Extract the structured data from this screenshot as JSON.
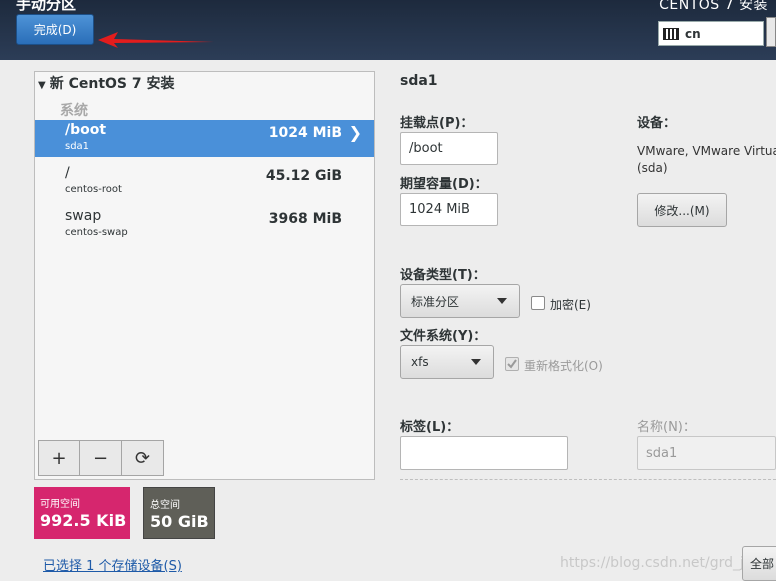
{
  "header": {
    "title": "手动分区",
    "product": "CENTOS 7 安装",
    "done_button": "完成(D)",
    "keyboard_layout": "cn"
  },
  "tree": {
    "root_label": "新 CentOS 7 安装",
    "group_label": "系统",
    "rows": [
      {
        "mount": "/boot",
        "device": "sda1",
        "size": "1024 MiB",
        "selected": true
      },
      {
        "mount": "/",
        "device": "centos-root",
        "size": "45.12 GiB",
        "selected": false
      },
      {
        "mount": "swap",
        "device": "centos-swap",
        "size": "3968 MiB",
        "selected": false
      }
    ]
  },
  "toolbar": {
    "add": "+",
    "remove": "−",
    "reload": "⟳"
  },
  "space": {
    "available_label": "可用空间",
    "available_value": "992.5 KiB",
    "total_label": "总空间",
    "total_value": "50 GiB"
  },
  "storage_link": "已选择 1 个存储设备(S)",
  "details": {
    "title": "sda1",
    "mount_point_label": "挂载点(P)：",
    "mount_point_value": "/boot",
    "capacity_label": "期望容量(D)：",
    "capacity_value": "1024 MiB",
    "device_label": "设备：",
    "device_text_line1": "VMware, VMware Virtua",
    "device_text_line2": "(sda)",
    "modify_button": "修改...(M)",
    "device_type_label": "设备类型(T)：",
    "device_type_value": "标准分区",
    "encrypt_label": "加密(E)",
    "filesystem_label": "文件系统(Y)：",
    "filesystem_value": "xfs",
    "reformat_label": "重新格式化(O)",
    "tag_label": "标签(L)：",
    "tag_value": "",
    "name_label": "名称(N)：",
    "name_value": "sda1",
    "reset_button": "全部"
  },
  "watermark": "https://blog.csdn.net/grd_java",
  "colors": {
    "selected_row": "#4a90d9",
    "available": "#d6266e",
    "total": "#5f5f58",
    "done_button": "#2a6eb8"
  }
}
